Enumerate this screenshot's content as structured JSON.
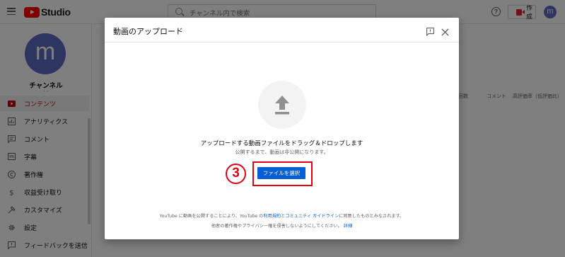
{
  "app": {
    "logo_text": "Studio"
  },
  "topbar": {
    "search_placeholder": "チャンネル内で検索",
    "help_glyph": "?",
    "create_label": "作成",
    "avatar_letter": "m"
  },
  "sidebar": {
    "avatar_letter": "m",
    "channel_name": "チャンネル",
    "channel_sub": "- -",
    "items": [
      {
        "label": "コンテンツ",
        "icon": "video-icon",
        "active": true
      },
      {
        "label": "アナリティクス",
        "icon": "analytics-icon"
      },
      {
        "label": "コメント",
        "icon": "comment-icon"
      },
      {
        "label": "字幕",
        "icon": "subtitles-icon"
      },
      {
        "label": "著作権",
        "icon": "copyright-icon"
      },
      {
        "label": "収益受け取り",
        "icon": "monetization-icon"
      },
      {
        "label": "カスタマイズ",
        "icon": "customize-icon"
      },
      {
        "label": "設定",
        "icon": "gear-icon"
      },
      {
        "label": "フィードバックを送信",
        "icon": "feedback-icon"
      }
    ]
  },
  "table_header": {
    "col_views": "回数",
    "col_comments": "コメント",
    "col_rating": "高評価率（低評価比）"
  },
  "dialog": {
    "title": "動画のアップロード",
    "main_text": "アップロードする動画ファイルをドラッグ＆ドロップします",
    "sub_text": "公開するまで、動画は非公開になります。",
    "select_button": "ファイルを選択",
    "step_marker": "3",
    "footer_line1_prefix": "YouTube に動画を公開することにより、YouTube の",
    "footer_link_terms": "利用規約",
    "footer_and": "と",
    "footer_link_guidelines": "コミュニティ ガイドライン",
    "footer_line1_suffix": "に同意したものとみなされます。",
    "footer_line2": "他者の著作権やプライバシー権を侵害しないようにしてください。",
    "footer_link_details": "詳細"
  },
  "colors": {
    "brand_red": "#ff0000",
    "accent_blue": "#065fd4",
    "highlight_red": "#e60012",
    "avatar": "#5c6bc0"
  }
}
